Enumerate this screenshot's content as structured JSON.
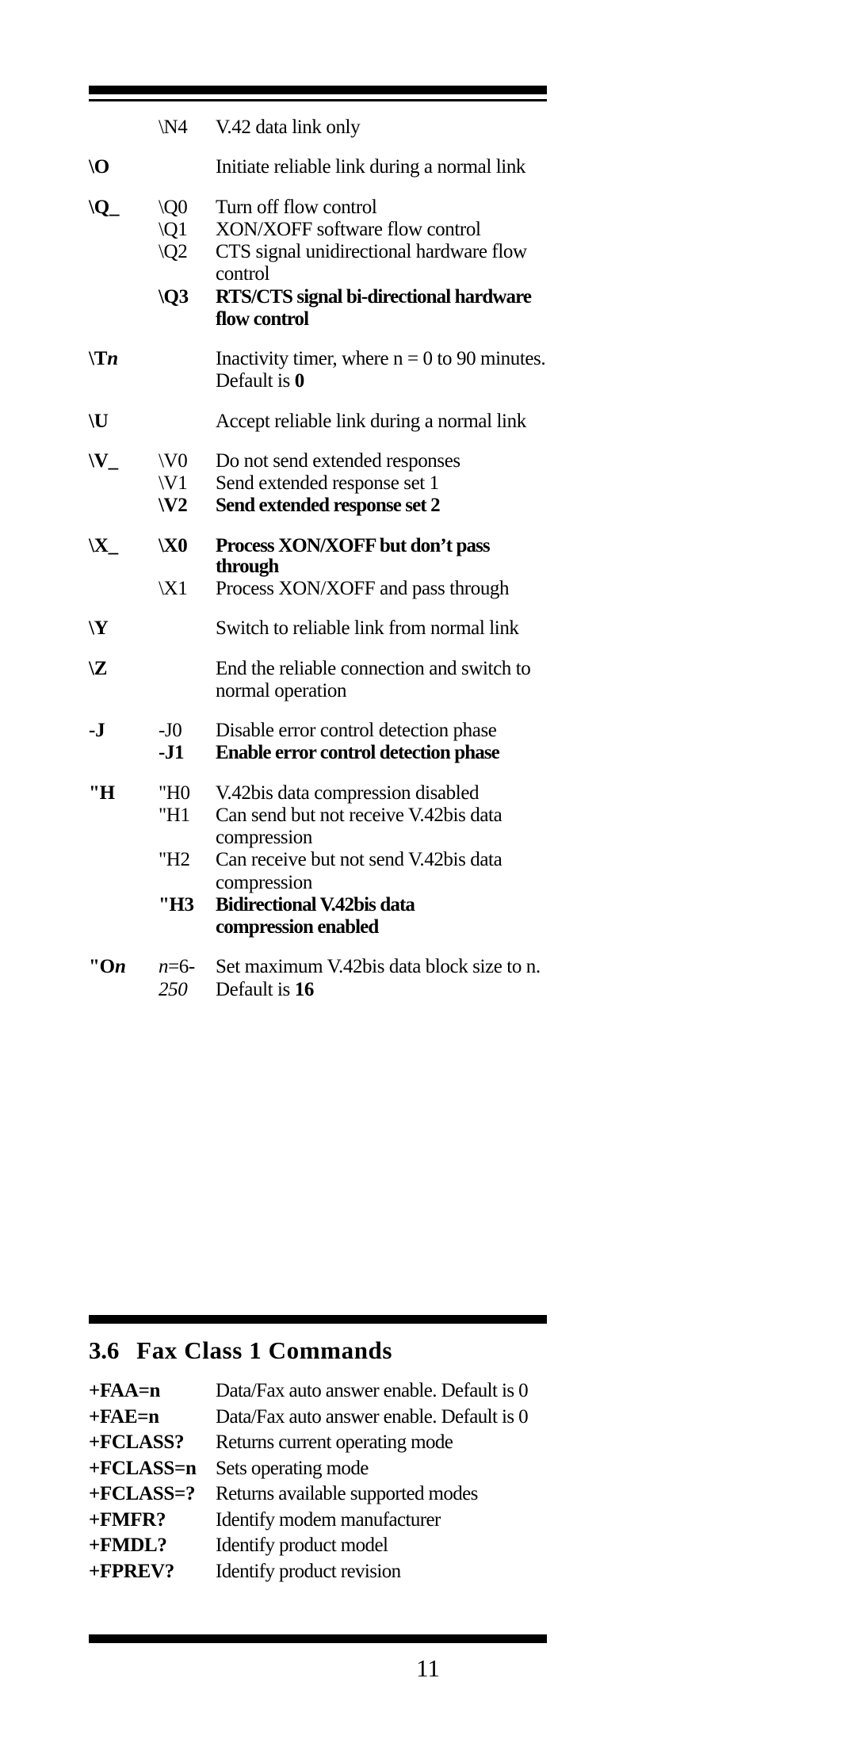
{
  "page": {
    "number": "11"
  },
  "data_commands": {
    "rows": [
      {
        "group": "",
        "sub": "\\N4",
        "desc": "V.42 data link only",
        "group_bold": true,
        "sub_bold": false,
        "desc_bold": false,
        "space_before": false
      },
      {
        "group": "\\O",
        "sub": "",
        "desc": "Initiate reliable link during a normal  link",
        "group_bold": true,
        "sub_bold": false,
        "desc_bold": false,
        "space_before": true
      },
      {
        "group": "\\Q_",
        "sub": "\\Q0",
        "desc": "Turn off flow control",
        "group_bold": true,
        "sub_bold": false,
        "desc_bold": false,
        "space_before": true
      },
      {
        "group": "",
        "sub": "\\Q1",
        "desc": "XON/XOFF software flow control",
        "group_bold": false,
        "sub_bold": false,
        "desc_bold": false,
        "space_before": false
      },
      {
        "group": "",
        "sub": "\\Q2",
        "desc": "CTS signal unidirectional hardware flow",
        "group_bold": false,
        "sub_bold": false,
        "desc_bold": false,
        "space_before": false
      },
      {
        "group": "",
        "sub": "",
        "desc": "control",
        "group_bold": false,
        "sub_bold": false,
        "desc_bold": false,
        "space_before": false
      },
      {
        "group": "",
        "sub": "\\Q3",
        "desc": "RTS/CTS signal bi-directional hardware",
        "group_bold": false,
        "sub_bold": true,
        "desc_bold": true,
        "space_before": false
      },
      {
        "group": "",
        "sub": "",
        "desc": "flow control",
        "group_bold": false,
        "sub_bold": false,
        "desc_bold": true,
        "space_before": false
      },
      {
        "group": "\\Tn",
        "sub": "",
        "desc": "Inactivity timer, where n = 0 to 90 minutes.",
        "group_bold": true,
        "sub_bold": false,
        "desc_bold": false,
        "space_before": true
      },
      {
        "group": "",
        "sub": "",
        "desc": "Default is 0",
        "group_bold": false,
        "sub_bold": false,
        "desc_bold": false,
        "space_before": false
      },
      {
        "group": "\\U",
        "sub": "",
        "desc": "Accept reliable link during a normal link",
        "group_bold": true,
        "sub_bold": false,
        "desc_bold": false,
        "space_before": true
      },
      {
        "group": "\\V_",
        "sub": "\\V0",
        "desc": "Do not send extended responses",
        "group_bold": true,
        "sub_bold": false,
        "desc_bold": false,
        "space_before": true
      },
      {
        "group": "",
        "sub": "\\V1",
        "desc": "Send extended response set 1",
        "group_bold": false,
        "sub_bold": false,
        "desc_bold": false,
        "space_before": false
      },
      {
        "group": "",
        "sub": "\\V2",
        "desc": "Send extended response set 2",
        "group_bold": false,
        "sub_bold": true,
        "desc_bold": true,
        "space_before": false
      },
      {
        "group": "\\X_",
        "sub": "\\X0",
        "desc": "Process XON/XOFF but don’t pass through",
        "group_bold": true,
        "sub_bold": true,
        "desc_bold": true,
        "space_before": true
      },
      {
        "group": "",
        "sub": "\\X1",
        "desc": "Process XON/XOFF and pass through",
        "group_bold": false,
        "sub_bold": false,
        "desc_bold": false,
        "space_before": false
      },
      {
        "group": "\\Y",
        "sub": "",
        "desc": "Switch to reliable link from normal link",
        "group_bold": true,
        "sub_bold": false,
        "desc_bold": false,
        "space_before": true
      },
      {
        "group": "\\Z",
        "sub": "",
        "desc": "End the reliable connection and switch to",
        "group_bold": true,
        "sub_bold": false,
        "desc_bold": false,
        "space_before": true
      },
      {
        "group": "",
        "sub": "",
        "desc": "normal operation",
        "group_bold": false,
        "sub_bold": false,
        "desc_bold": false,
        "space_before": false
      },
      {
        "group": "-J",
        "sub": "-J0",
        "desc": "Disable error control detection phase",
        "group_bold": true,
        "sub_bold": false,
        "desc_bold": false,
        "space_before": true
      },
      {
        "group": "",
        "sub": "-J1",
        "desc": "Enable error control detection phase",
        "group_bold": false,
        "sub_bold": true,
        "desc_bold": true,
        "space_before": false
      },
      {
        "group": "\"H",
        "sub": "\"H0",
        "desc": "V.42bis data compression disabled",
        "group_bold": true,
        "sub_bold": false,
        "desc_bold": false,
        "space_before": true
      },
      {
        "group": "",
        "sub": "\"H1",
        "desc": "Can send but not receive V.42bis data",
        "group_bold": false,
        "sub_bold": false,
        "desc_bold": false,
        "space_before": false
      },
      {
        "group": "",
        "sub": "",
        "desc": "compression",
        "group_bold": false,
        "sub_bold": false,
        "desc_bold": false,
        "space_before": false
      },
      {
        "group": "",
        "sub": "\"H2",
        "desc": "Can receive but not send V.42bis data",
        "group_bold": false,
        "sub_bold": false,
        "desc_bold": false,
        "space_before": false
      },
      {
        "group": "",
        "sub": "",
        "desc": "compression",
        "group_bold": false,
        "sub_bold": false,
        "desc_bold": false,
        "space_before": false
      },
      {
        "group": "",
        "sub": "\"H3",
        "desc": "Bidirectional V.42bis data",
        "group_bold": false,
        "sub_bold": true,
        "desc_bold": true,
        "space_before": false
      },
      {
        "group": "",
        "sub": "",
        "desc": "compression enabled",
        "group_bold": false,
        "sub_bold": false,
        "desc_bold": true,
        "space_before": false
      },
      {
        "group": "\"On",
        "sub": "n=6-",
        "desc": "Set maximum V.42bis data block size to n.",
        "group_bold": true,
        "sub_bold": false,
        "desc_bold": false,
        "space_before": true
      },
      {
        "group": "",
        "sub": "250",
        "desc": "Default is 16",
        "group_bold": false,
        "sub_bold": false,
        "desc_bold": false,
        "space_before": false
      }
    ]
  },
  "section": {
    "number": "3.6",
    "title": "Fax Class 1 Commands"
  },
  "fax_commands": {
    "rows": [
      {
        "cmd": "+FAA=n",
        "desc": "Data/Fax auto answer enable. Default is 0"
      },
      {
        "cmd": "+FAE=n",
        "desc": "Data/Fax auto answer enable. Default is 0"
      },
      {
        "cmd": "+FCLASS?",
        "desc": "Returns current operating mode"
      },
      {
        "cmd": "+FCLASS=n",
        "desc": "Sets operating mode"
      },
      {
        "cmd": "+FCLASS=?",
        "desc": "Returns  available supported modes"
      },
      {
        "cmd": "+FMFR?",
        "desc": "Identify modem manufacturer"
      },
      {
        "cmd": "+FMDL?",
        "desc": "Identify product model"
      },
      {
        "cmd": "+FPREV?",
        "desc": "Identify product revision"
      }
    ]
  }
}
